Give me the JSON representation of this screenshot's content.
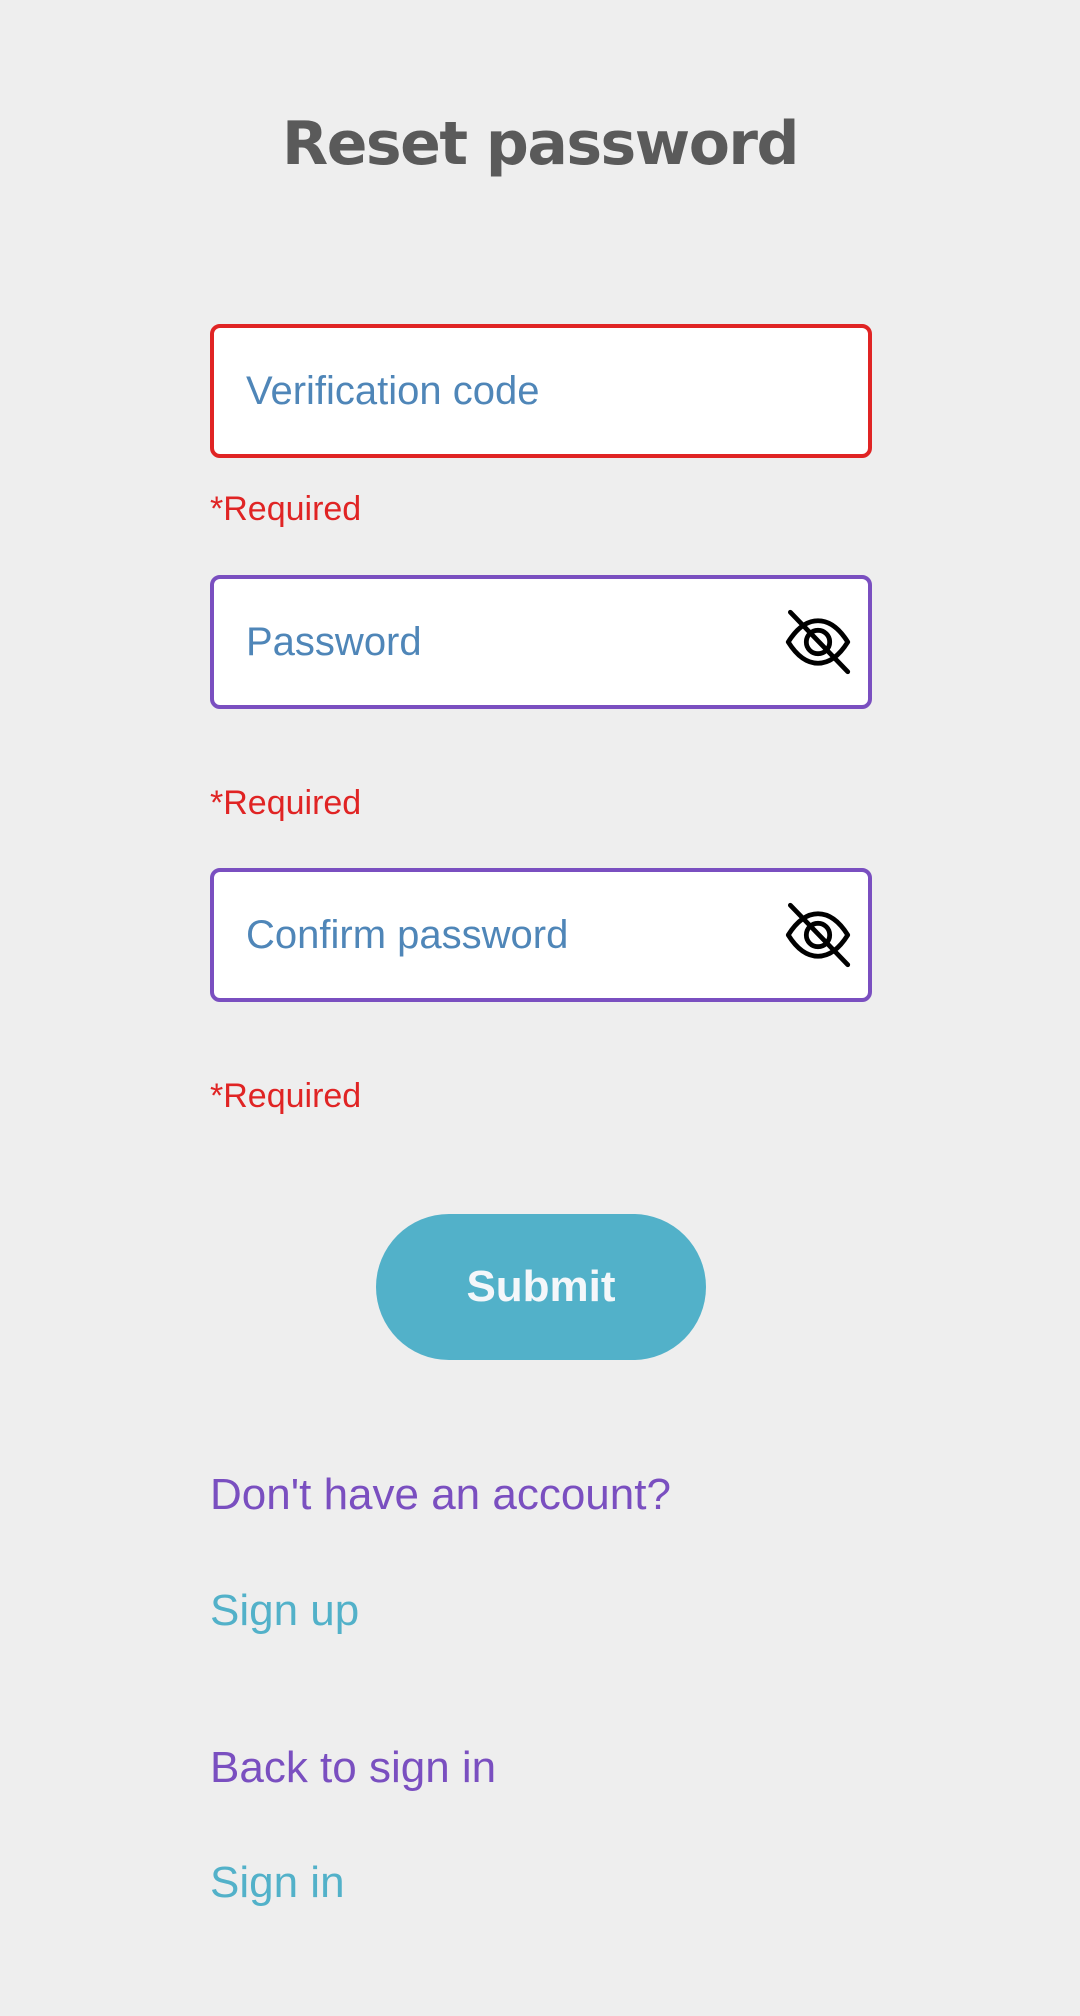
{
  "page": {
    "title": "Reset password"
  },
  "form": {
    "verification_code": {
      "placeholder": "Verification code",
      "value": "",
      "error": "*Required"
    },
    "password": {
      "placeholder": "Password",
      "value": "",
      "error": "*Required",
      "toggle_icon": "eye-off-icon"
    },
    "confirm_password": {
      "placeholder": "Confirm password",
      "value": "",
      "error": "*Required",
      "toggle_icon": "eye-off-icon"
    },
    "submit_label": "Submit"
  },
  "footer": {
    "no_account_text": "Don't have an account?",
    "sign_up_link": "Sign up",
    "back_text": "Back to sign in",
    "sign_in_link": "Sign in"
  },
  "colors": {
    "background": "#eeeeee",
    "error": "#e02424",
    "accent_purple": "#7a4fc0",
    "accent_teal": "#52b1c9",
    "placeholder": "#4f86b8",
    "title": "#5a5a5a"
  }
}
